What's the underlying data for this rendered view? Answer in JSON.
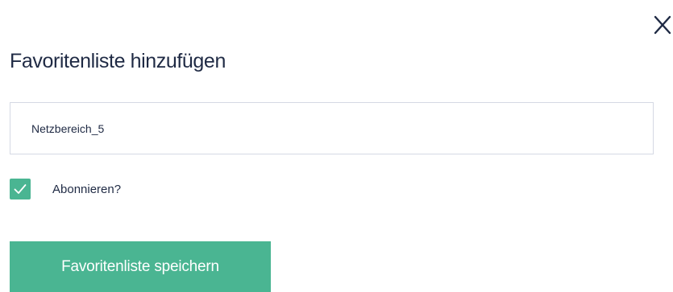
{
  "dialog": {
    "title": "Favoritenliste hinzufügen",
    "close_icon": "close-icon",
    "name_input": {
      "value": "Netzbereich_5"
    },
    "subscribe": {
      "label": "Abonnieren?",
      "checked": true,
      "checkbox_icon": "checkmark-icon"
    },
    "save_label": "Favoritenliste speichern"
  },
  "colors": {
    "accent": "#4ab592",
    "text": "#1f2a44",
    "input_border": "#d5d9e4",
    "background": "#ffffff"
  }
}
